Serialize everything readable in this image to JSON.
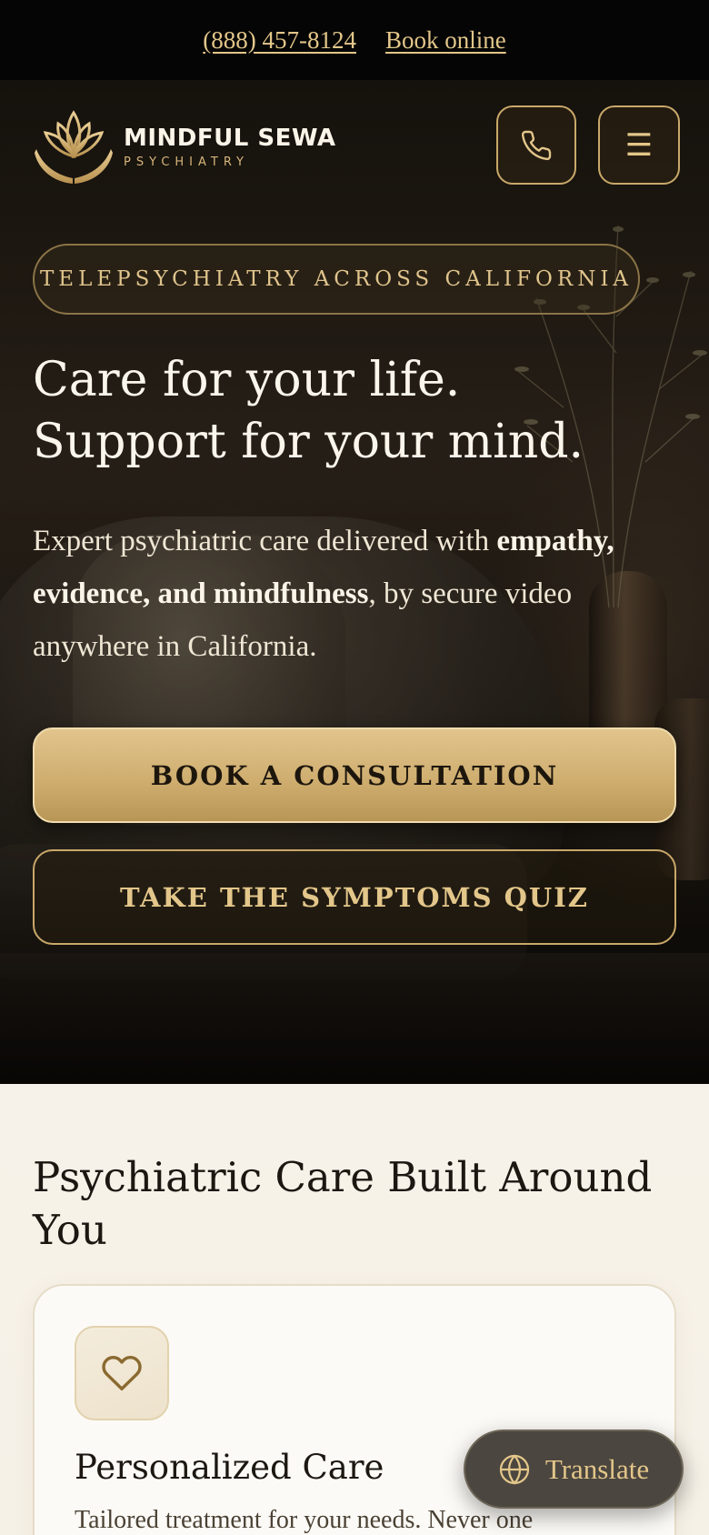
{
  "topbar": {
    "phone": "(888) 457-8124",
    "book_online": "Book online"
  },
  "header": {
    "brand_name": "MINDFUL SEWA",
    "brand_sub": "PSYCHIATRY",
    "icons": {
      "phone": "phone-icon",
      "menu": "menu-icon",
      "logo": "lotus-hands-logo"
    },
    "menu_glyph": "☰"
  },
  "hero": {
    "pill": "TELEPSYCHIATRY ACROSS CALIFORNIA",
    "headline_line1": "Care for your life.",
    "headline_line2": "Support for your mind.",
    "lead_part1": "Expert psychiatric care delivered with ",
    "lead_bold": "empathy, evidence, and mindfulness",
    "lead_part2": ", by secure video anywhere in California.",
    "cta_primary": "BOOK A CONSULTATION",
    "cta_secondary": "TAKE THE SYMPTOMS QUIZ"
  },
  "care": {
    "title": "Psychiatric Care Built Around You",
    "card": {
      "icon": "heart-icon",
      "title": "Personalized Care",
      "body": "Tailored treatment for your needs. Never one"
    }
  },
  "translate": {
    "label": "Translate",
    "icon": "globe-icon"
  },
  "colors": {
    "gold": "#e3c68a",
    "gold_button": "#cfae70",
    "dark_bg": "#050505",
    "light_bg": "#f7f2e9"
  }
}
